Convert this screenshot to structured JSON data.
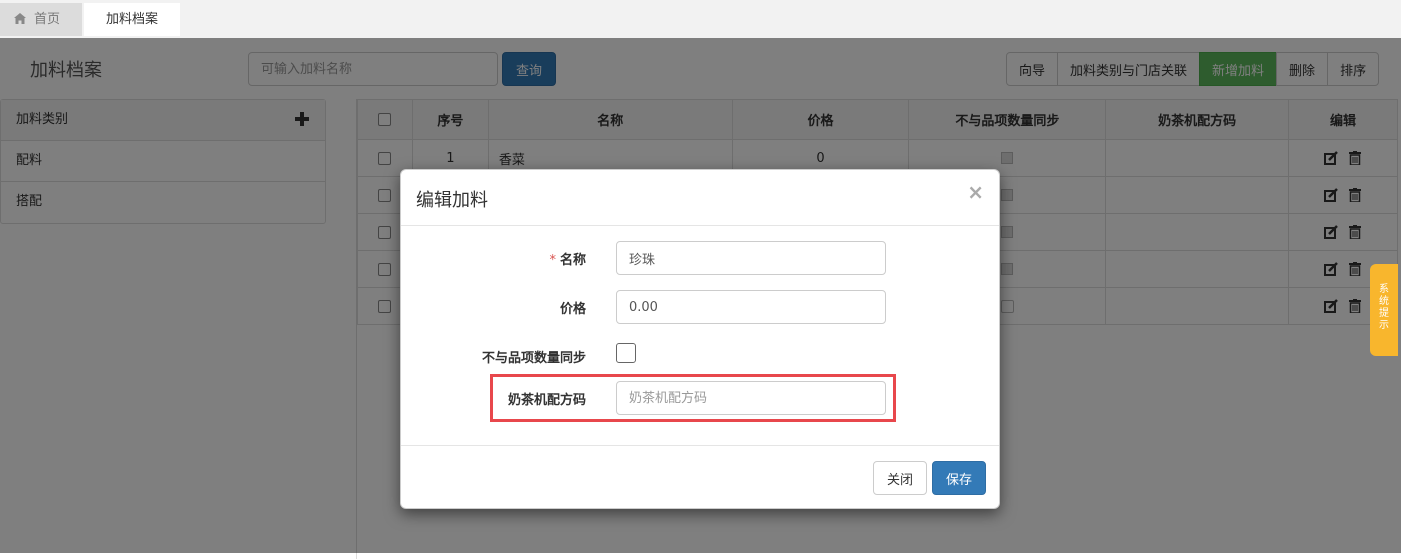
{
  "tabs": {
    "home": "首页",
    "active": "加料档案"
  },
  "header": {
    "title": "加料档案",
    "search_placeholder": "可输入加料名称",
    "query_label": "查询",
    "actions": [
      "向导",
      "加料类别与门店关联",
      "新增加料",
      "删除",
      "排序"
    ]
  },
  "sidebar": {
    "head": "加料类别",
    "items": [
      "配料",
      "搭配"
    ]
  },
  "table": {
    "columns": [
      "序号",
      "名称",
      "价格",
      "不与品项数量同步",
      "奶茶机配方码",
      "编辑"
    ],
    "rows": [
      {
        "index": "1",
        "name": "香菜",
        "price": "0"
      },
      {
        "index": "",
        "name": "",
        "price": ""
      },
      {
        "index": "",
        "name": "",
        "price": ""
      },
      {
        "index": "",
        "name": "",
        "price": ""
      },
      {
        "index": "",
        "name": "",
        "price": ""
      }
    ]
  },
  "side_tab": [
    "系",
    "统",
    "提",
    "示"
  ],
  "modal": {
    "title": "编辑加料",
    "close_symbol": "×",
    "name_label": "名称",
    "required_mark": "*",
    "name_value": "珍珠",
    "price_label": "价格",
    "price_value": "0.00",
    "sync_label": "不与品项数量同步",
    "recipe_label": "奶茶机配方码",
    "recipe_placeholder": "奶茶机配方码",
    "close_label": "关闭",
    "save_label": "保存"
  },
  "colors": {
    "primary": "#337ab7",
    "success": "#5cb85c",
    "highlight": "#e8474c",
    "side_tab": "#f8b62d"
  },
  "icons": [
    "home-icon",
    "plus-icon",
    "edit-icon",
    "trash-icon",
    "close-icon"
  ]
}
